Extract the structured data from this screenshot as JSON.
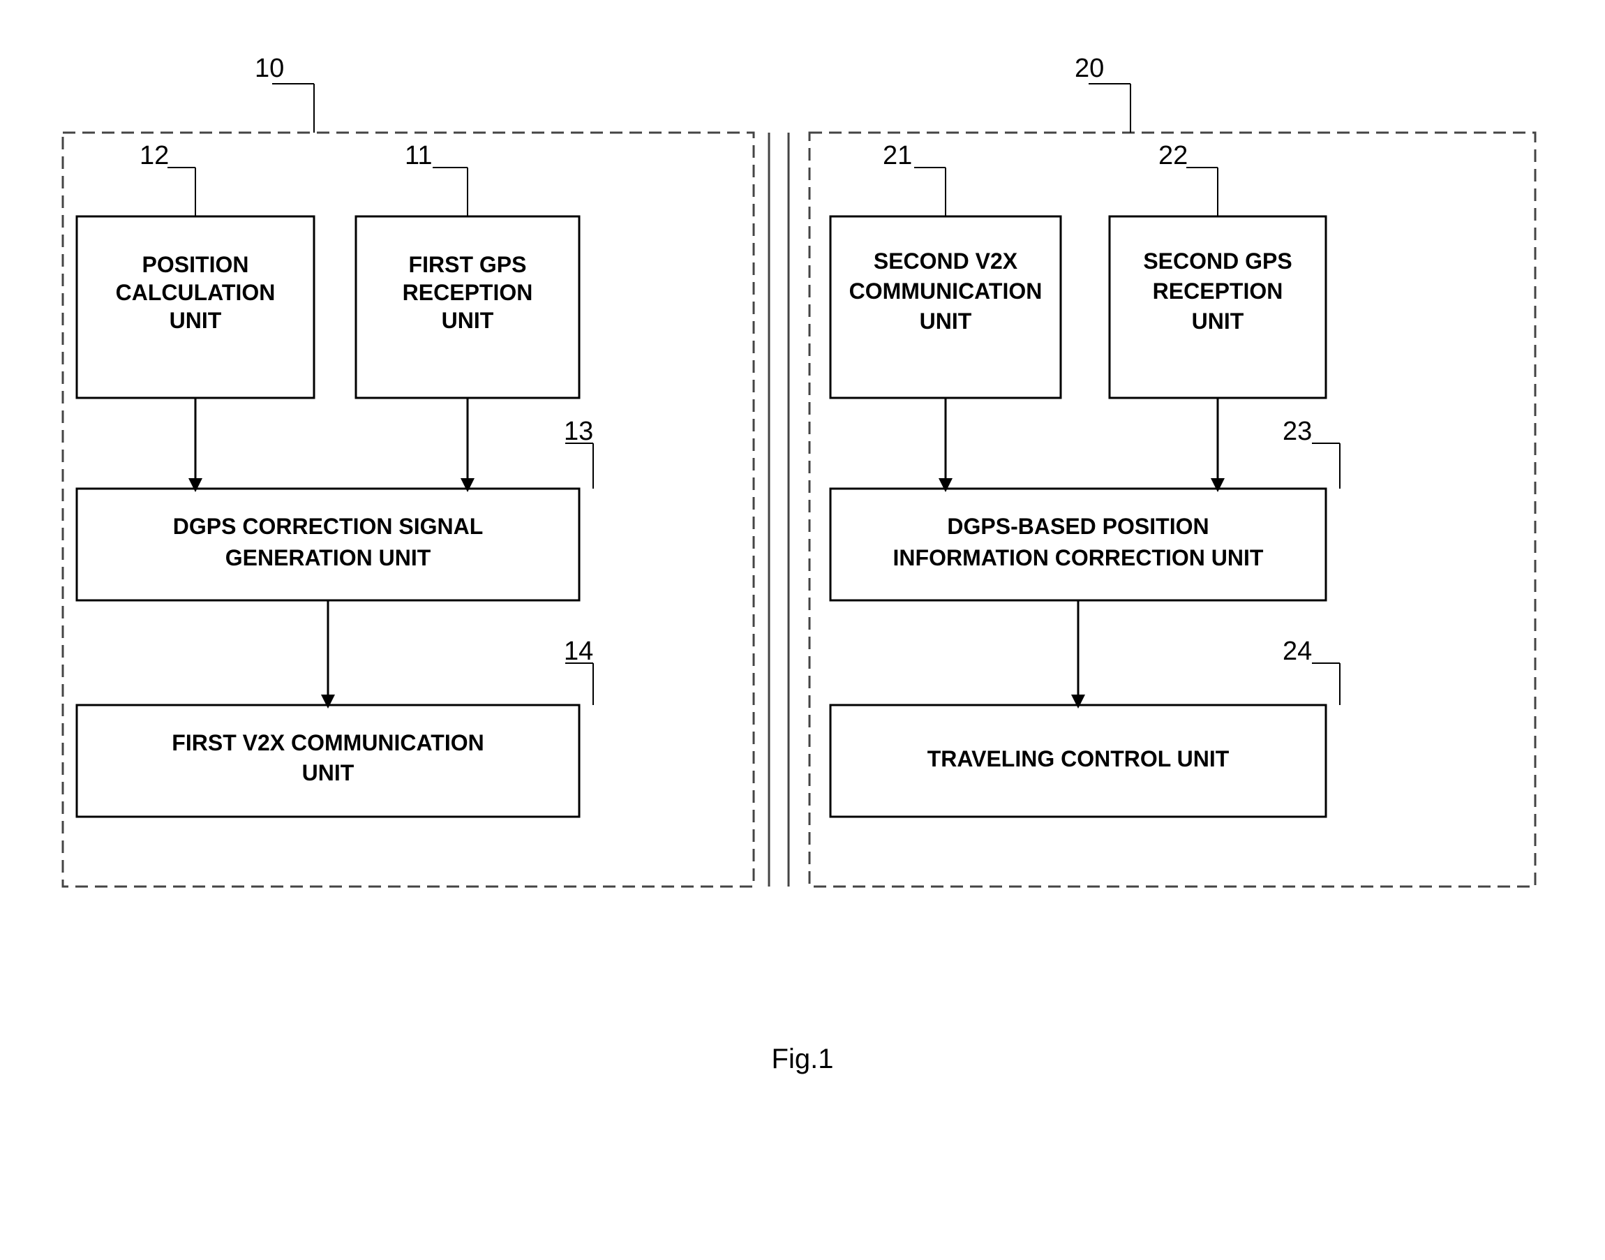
{
  "diagram": {
    "figure_label": "Fig.1",
    "ref_numbers": {
      "r10": "10",
      "r11": "11",
      "r12": "12",
      "r13": "13",
      "r14": "14",
      "r20": "20",
      "r21": "21",
      "r22": "22",
      "r23": "23",
      "r24": "24"
    },
    "boxes": {
      "position_calc": "POSITION\nCALCULATION\nUNIT",
      "first_gps": "FIRST GPS\nRECEPTION\nUNIT",
      "dgps_correction": "DGPS CORRECTION SIGNAL\nGENERATION UNIT",
      "first_v2x": "FIRST V2X COMMUNICATION\nUNIT",
      "second_v2x": "SECOND V2X\nCOMMUNICATION\nUNIT",
      "second_gps": "SECOND GPS\nRECEPTION\nUNIT",
      "dgps_position": "DGPS-BASED POSITION\nINFORMATION CORRECTION UNIT",
      "traveling_control": "TRAVELING CONTROL UNIT"
    }
  }
}
